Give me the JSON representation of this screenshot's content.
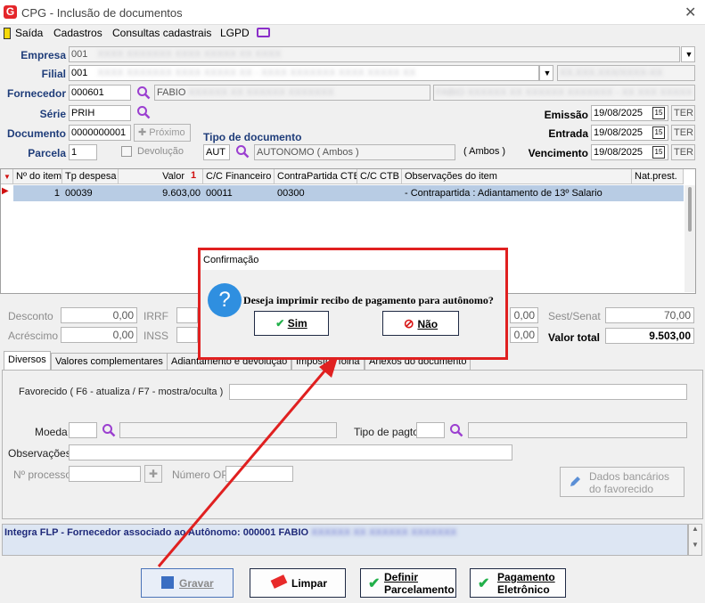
{
  "window": {
    "title": "CPG - Inclusão de documentos",
    "logo_letter": "G"
  },
  "menu": {
    "saida": "Saída",
    "cadastros": "Cadastros",
    "consultas": "Consultas cadastrais",
    "lgpd": "LGPD"
  },
  "header": {
    "empresa_label": "Empresa",
    "empresa_code": "001",
    "empresa_name": "XXXX XXXXXXX XXXX XXXXX XX XXXX",
    "filial_label": "Filial",
    "filial_code": "001",
    "filial_name": "XXXX XXXXXXX XXXX XXXXX XX - XXXX XXXXXXX XXXX XXXXX XX",
    "filial_cnpj": "XX.XXX.XXX/XXXX-XX",
    "fornecedor_label": "Fornecedor",
    "fornecedor_code": "000601",
    "fornecedor_name": "FABIO",
    "fornecedor_name_blur": "XXXXXX XX XXXXXX XXXXXXX",
    "fornecedor_full_blur": "FABIO XXXXXX XX XXXXXX XXXXXXX - XX XXX XXXXX",
    "serie_label": "Série",
    "serie_value": "PRIH",
    "documento_label": "Documento",
    "documento_value": "0000000001",
    "proximo_label": "Próximo",
    "parcela_label": "Parcela",
    "parcela_value": "1",
    "devolucao_label": "Devolução",
    "tipo_doc_label": "Tipo de documento",
    "tipo_doc_code": "AUT",
    "tipo_doc_name": "AUTONOMO ( Ambos )",
    "tipo_doc_extra": "( Ambos )",
    "emissao_label": "Emissão",
    "emissao_value": "19/08/2025",
    "emissao_day": "TER",
    "entrada_label": "Entrada",
    "entrada_value": "19/08/2025",
    "entrada_day": "TER",
    "vencimento_label": "Vencimento",
    "vencimento_value": "19/08/2025",
    "vencimento_day": "TER",
    "cal_glyph": "15"
  },
  "grid": {
    "columns": [
      "Nº do item",
      "Tp despesa",
      "Valor",
      "C/C Financeiro",
      "ContraPartida CTB",
      "C/C CTB",
      "Observações do item",
      "Nat.prest."
    ],
    "sort_marker": "1",
    "rows": [
      {
        "item": "1",
        "tp_despesa": "00039",
        "valor": "9.603,00",
        "cc_fin": "00011",
        "contrapartida": "00300",
        "cc_ctb": "",
        "obs": "- Contrapartida : Adiantamento de 13º Salario",
        "nat": ""
      }
    ]
  },
  "totals": {
    "desconto_label": "Desconto",
    "desconto_value": "0,00",
    "acrescimo_label": "Acréscimo",
    "acrescimo_value": "0,00",
    "irrf_label": "IRRF",
    "inss_label": "INSS",
    "mid_value_1": "0,00",
    "mid_value_2": "0,00",
    "sest_label": "Sest/Senat",
    "sest_value": "70,00",
    "valor_total_label": "Valor total",
    "valor_total_value": "9.503,00"
  },
  "tabs": [
    "Diversos",
    "Valores complementares",
    "Adiantamento e devolução",
    "Impostos folha",
    "Anexos do documento"
  ],
  "panel": {
    "favorecido_label": "Favorecido ( F6 - atualiza / F7 - mostra/oculta )",
    "moeda_label": "Moeda",
    "tipo_pagto_label": "Tipo de pagto",
    "observacoes_label": "Observações",
    "processo_label": "Nº processo",
    "numero_op_label": "Número OP",
    "dados_bancarios_label_1": "Dados bancários",
    "dados_bancarios_label_2": "do favorecido"
  },
  "status": {
    "text": "Integra FLP - Fornecedor associado ao Autônomo: 000001 FABIO",
    "blur": "XXXXXX XX XXXXXX XXXXXXX"
  },
  "buttons": {
    "gravar": "Gravar",
    "limpar": "Limpar",
    "definir_1": "Definir",
    "definir_2": "Parcelamento",
    "pagamento_1": "Pagamento",
    "pagamento_2": "Eletrônico"
  },
  "dialog": {
    "title": "Confirmação",
    "message": "Deseja imprimir recibo de pagamento para autônomo?",
    "yes": "Sim",
    "no": "Não",
    "icon": "?"
  },
  "colors": {
    "accent_red": "#e02020",
    "label_blue": "#1f3d7a",
    "selected_row": "#b8cce4"
  }
}
